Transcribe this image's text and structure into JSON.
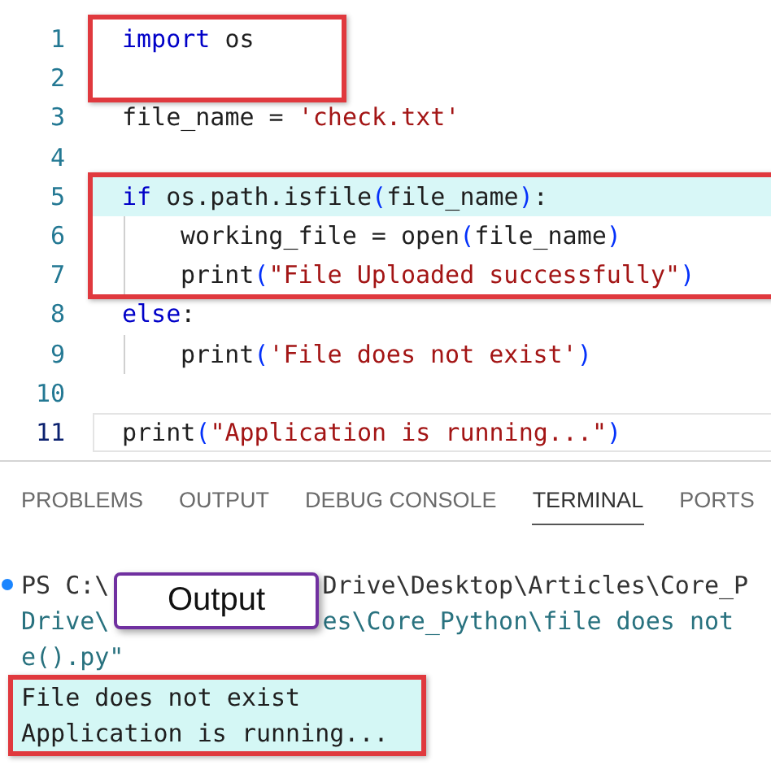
{
  "editor": {
    "blocks": [
      {
        "boxed": true,
        "lines": [
          {
            "number": "1",
            "indented": false,
            "highlighted": false,
            "current": false,
            "tokens": [
              {
                "text": "import",
                "kind": "keyword"
              },
              {
                "text": " os",
                "kind": "plain"
              }
            ]
          },
          {
            "number": "2",
            "indented": false,
            "highlighted": false,
            "current": false
          }
        ]
      },
      {
        "boxed": false,
        "lines": [
          {
            "number": "3",
            "indented": false,
            "highlighted": false,
            "current": false,
            "tokens": [
              {
                "text": "file_name = ",
                "kind": "plain"
              },
              {
                "text": "'check.txt'",
                "kind": "string"
              }
            ]
          },
          {
            "number": "4",
            "indented": false,
            "highlighted": false,
            "current": false
          }
        ]
      },
      {
        "boxed": true,
        "lines": [
          {
            "number": "5",
            "indented": false,
            "highlighted": true,
            "current": false,
            "tokens": [
              {
                "text": "if",
                "kind": "keyword"
              },
              {
                "text": " os.path.isfile",
                "kind": "plain"
              },
              {
                "text": "(",
                "kind": "bracket"
              },
              {
                "text": "file_name",
                "kind": "plain"
              },
              {
                "text": ")",
                "kind": "bracket"
              },
              {
                "text": ":",
                "kind": "plain"
              }
            ]
          },
          {
            "number": "6",
            "indented": true,
            "highlighted": false,
            "current": false,
            "tokens": [
              {
                "text": "working_file = open",
                "kind": "plain"
              },
              {
                "text": "(",
                "kind": "bracket"
              },
              {
                "text": "file_name",
                "kind": "plain"
              },
              {
                "text": ")",
                "kind": "bracket"
              }
            ]
          },
          {
            "number": "7",
            "indented": true,
            "highlighted": false,
            "current": false,
            "tokens": [
              {
                "text": "print",
                "kind": "plain"
              },
              {
                "text": "(",
                "kind": "bracket"
              },
              {
                "text": "\"File Uploaded successfully\"",
                "kind": "string"
              },
              {
                "text": ")",
                "kind": "bracket"
              }
            ]
          }
        ]
      },
      {
        "boxed": false,
        "lines": [
          {
            "number": "8",
            "indented": false,
            "highlighted": false,
            "current": false,
            "tokens": [
              {
                "text": "else",
                "kind": "keyword"
              },
              {
                "text": ":",
                "kind": "plain"
              }
            ]
          },
          {
            "number": "9",
            "indented": true,
            "highlighted": false,
            "current": false,
            "tokens": [
              {
                "text": "print",
                "kind": "plain"
              },
              {
                "text": "(",
                "kind": "bracket"
              },
              {
                "text": "'File does not exist'",
                "kind": "string"
              },
              {
                "text": ")",
                "kind": "bracket"
              }
            ]
          },
          {
            "number": "10",
            "indented": false,
            "highlighted": false,
            "current": false
          },
          {
            "number": "11",
            "indented": false,
            "highlighted": false,
            "current": true,
            "tokens": [
              {
                "text": "print",
                "kind": "plain"
              },
              {
                "text": "(",
                "kind": "bracket"
              },
              {
                "text": "\"Application is running...\"",
                "kind": "string"
              },
              {
                "text": ")",
                "kind": "bracket"
              }
            ]
          }
        ]
      }
    ]
  },
  "panel": {
    "tabs": [
      {
        "label": "PROBLEMS",
        "selected": false
      },
      {
        "label": "OUTPUT",
        "selected": false
      },
      {
        "label": "DEBUG CONSOLE",
        "selected": false
      },
      {
        "label": "TERMINAL",
        "selected": true
      },
      {
        "label": "PORTS",
        "selected": false
      }
    ],
    "terminal": [
      {
        "kind": "command",
        "dot": true,
        "segments": [
          {
            "text": "PS C:\\",
            "kind": "prompt"
          },
          {
            "text": "Drive\\Desktop\\Articles\\Core_P",
            "kind": "prompt"
          }
        ]
      },
      {
        "kind": "command",
        "dot": false,
        "segments": [
          {
            "text": "Drive\\",
            "kind": "path"
          },
          {
            "text": "es\\Core_Python\\file does not",
            "kind": "path"
          }
        ]
      },
      {
        "kind": "command",
        "dot": false,
        "segments": [
          {
            "text": "e().py\"",
            "kind": "path"
          }
        ]
      },
      {
        "kind": "output",
        "dot": false,
        "segments": [
          {
            "text": "File does not exist",
            "kind": "output"
          }
        ]
      },
      {
        "kind": "output",
        "dot": false,
        "segments": [
          {
            "text": "Application is running...",
            "kind": "output"
          }
        ]
      }
    ],
    "callout": {
      "text": "Output"
    }
  }
}
